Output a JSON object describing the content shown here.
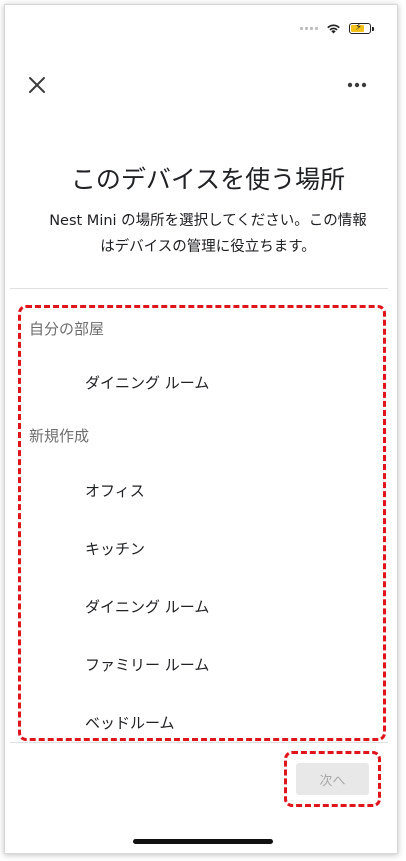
{
  "header": {
    "close_icon": "close-icon",
    "more_icon": "more-horizontal-icon"
  },
  "title": "このデバイスを使う場所",
  "subtitle": "Nest Mini の場所を選択してください。この情報はデバイスの管理に役立ちます。",
  "sections": [
    {
      "header": "自分の部屋",
      "items": [
        "ダイニング ルーム"
      ]
    },
    {
      "header": "新規作成",
      "items": [
        "オフィス",
        "キッチン",
        "ダイニング ルーム",
        "ファミリー ルーム",
        "ベッドルーム"
      ]
    }
  ],
  "footer": {
    "next_label": "次へ"
  },
  "colors": {
    "highlight_dashed": "#e0151b",
    "disabled_button_bg": "#e8e8e8",
    "disabled_button_text": "#a8a8a8"
  }
}
